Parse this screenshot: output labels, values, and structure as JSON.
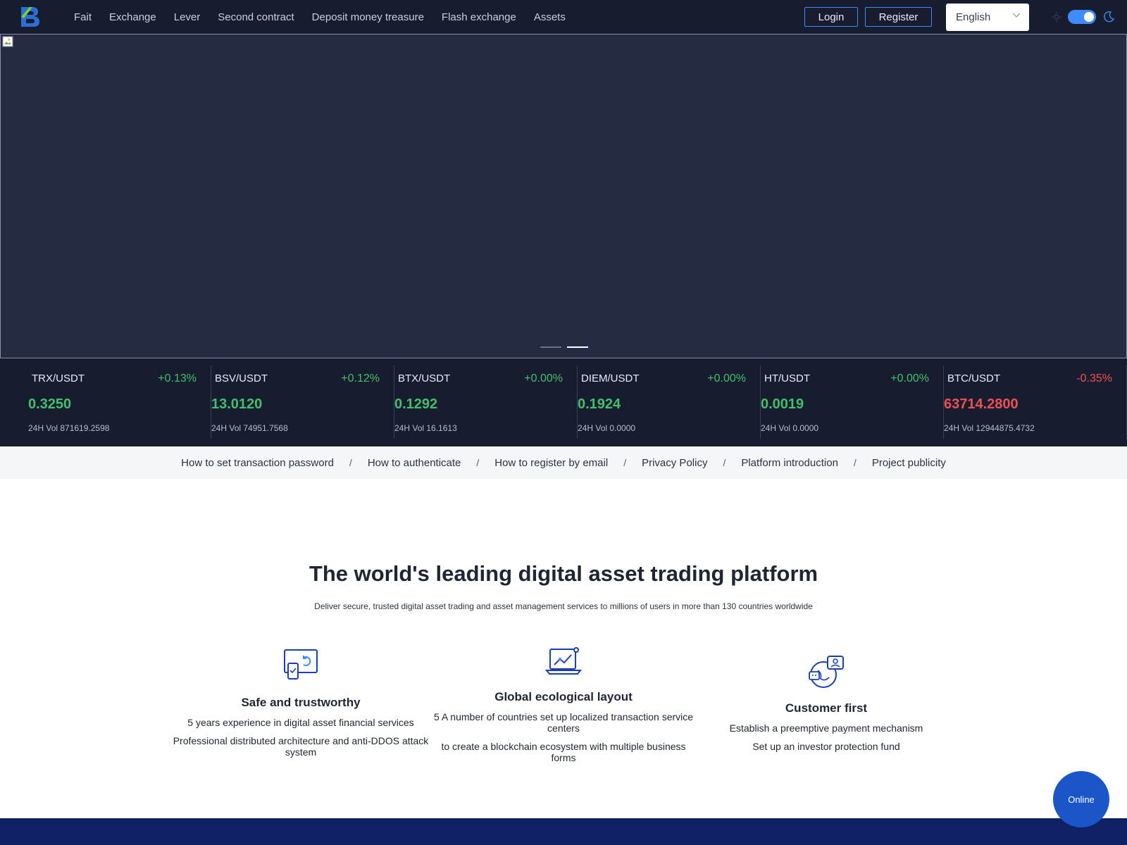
{
  "header": {
    "nav": [
      "Fait",
      "Exchange",
      "Lever",
      "Second contract",
      "Deposit money treasure",
      "Flash exchange",
      "Assets"
    ],
    "login_label": "Login",
    "register_label": "Register",
    "language": "English",
    "theme": "dark"
  },
  "banner": {
    "slides": 2,
    "active_slide": 2
  },
  "tickers": [
    {
      "pair": "TRX/USDT",
      "change": "+0.13%",
      "price": "0.3250",
      "vol": "24H Vol 871619.2598",
      "trend": "up"
    },
    {
      "pair": "BSV/USDT",
      "change": "+0.12%",
      "price": "13.0120",
      "vol": "24H Vol 74951.7568",
      "trend": "up"
    },
    {
      "pair": "BTX/USDT",
      "change": "+0.00%",
      "price": "0.1292",
      "vol": "24H Vol 16.1613",
      "trend": "up"
    },
    {
      "pair": "DIEM/USDT",
      "change": "+0.00%",
      "price": "0.1924",
      "vol": "24H Vol 0.0000",
      "trend": "up"
    },
    {
      "pair": "HT/USDT",
      "change": "+0.00%",
      "price": "0.0019",
      "vol": "24H Vol 0.0000",
      "trend": "up"
    },
    {
      "pair": "BTC/USDT",
      "change": "-0.35%",
      "price": "63714.2800",
      "vol": "24H Vol 12944875.4732",
      "trend": "down"
    }
  ],
  "help_links": [
    "How to set transaction password",
    "How to authenticate",
    "How to register by email",
    "Privacy Policy",
    "Platform introduction",
    "Project publicity"
  ],
  "help_separator": "/",
  "intro": {
    "title": "The world's leading digital asset trading platform",
    "subtitle": "Deliver secure, trusted digital asset trading and asset management services to millions of users in more than 130 countries worldwide"
  },
  "features": [
    {
      "title": "Safe and trustworthy",
      "lines": [
        "5 years experience in digital asset financial services",
        "Professional distributed architecture and anti-DDOS attack system"
      ],
      "icon": "device-sync-icon"
    },
    {
      "title": "Global ecological layout",
      "lines": [
        "5 A number of countries set up localized transaction service centers",
        "to create a blockchain ecosystem with multiple business forms"
      ],
      "icon": "laptop-chart-icon"
    },
    {
      "title": "Customer first",
      "lines": [
        "Establish a preemptive payment mechanism",
        "Set up an investor protection fund"
      ],
      "icon": "globe-support-icon"
    }
  ],
  "chat": {
    "label": "Online"
  },
  "colors": {
    "header_bg": "#171c2e",
    "banner_bg": "#262b44",
    "accent": "#3d8bff",
    "up": "#3fc16c",
    "down": "#ef5055",
    "footer_band": "#0f2064",
    "chat_bg": "#1a56c9"
  }
}
